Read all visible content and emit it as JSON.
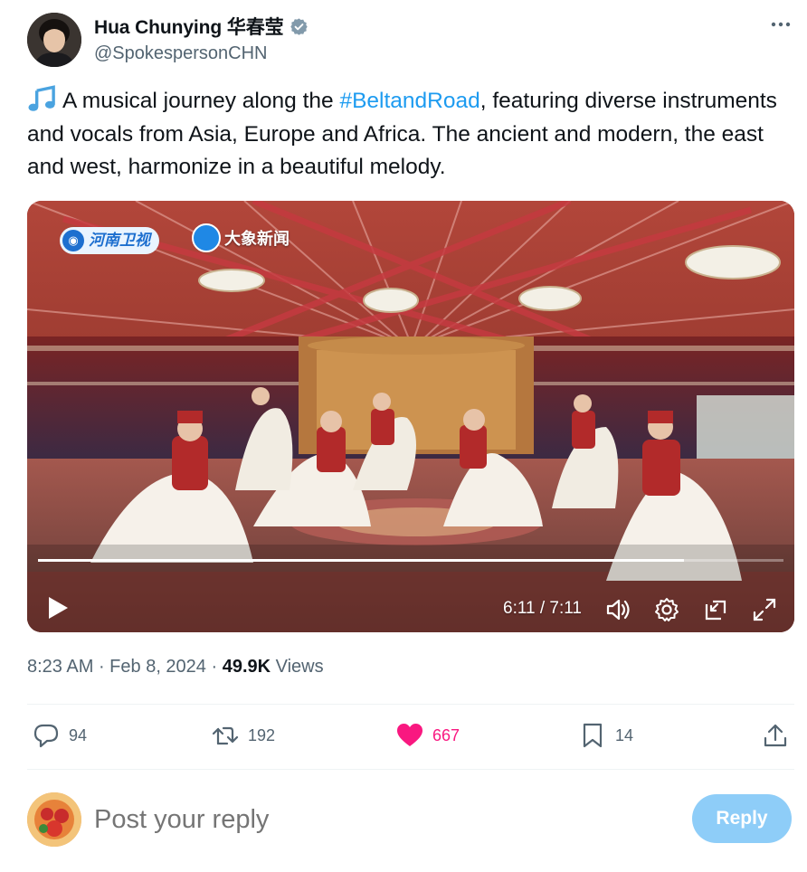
{
  "author": {
    "name": "Hua Chunying 华春莹",
    "handle": "@SpokespersonCHN",
    "verified_icon": "verified-badge-icon"
  },
  "tweet": {
    "text_before_hashtag": "A musical journey along the ",
    "hashtag": "#BeltandRoad",
    "text_after_hashtag": ", featuring diverse instruments and vocals from Asia, Europe and Africa. The ancient and modern, the east and west, harmonize in a beautiful melody.",
    "leading_emoji": "music-notes-icon"
  },
  "video": {
    "logo_left": "河南卫视",
    "logo_right": "大象新闻",
    "current_time": "6:11",
    "separator": " / ",
    "duration": "7:11",
    "progress": 0.866,
    "controls": [
      "play-icon",
      "volume-icon",
      "settings-icon",
      "pip-icon",
      "fullscreen-icon"
    ]
  },
  "meta": {
    "time": "8:23 AM",
    "dot": " · ",
    "date": "Feb 8, 2024",
    "dot2": " · ",
    "views_count": "49.9K",
    "views_label": " Views"
  },
  "actions": {
    "replies": "94",
    "reposts": "192",
    "likes": "667",
    "bookmarks": "14"
  },
  "reply": {
    "placeholder": "Post your reply",
    "button_label": "Reply"
  },
  "colors": {
    "link": "#1d9bf0",
    "like": "#f91880",
    "secondary": "#536471",
    "reply_button": "#8ecdf8"
  }
}
